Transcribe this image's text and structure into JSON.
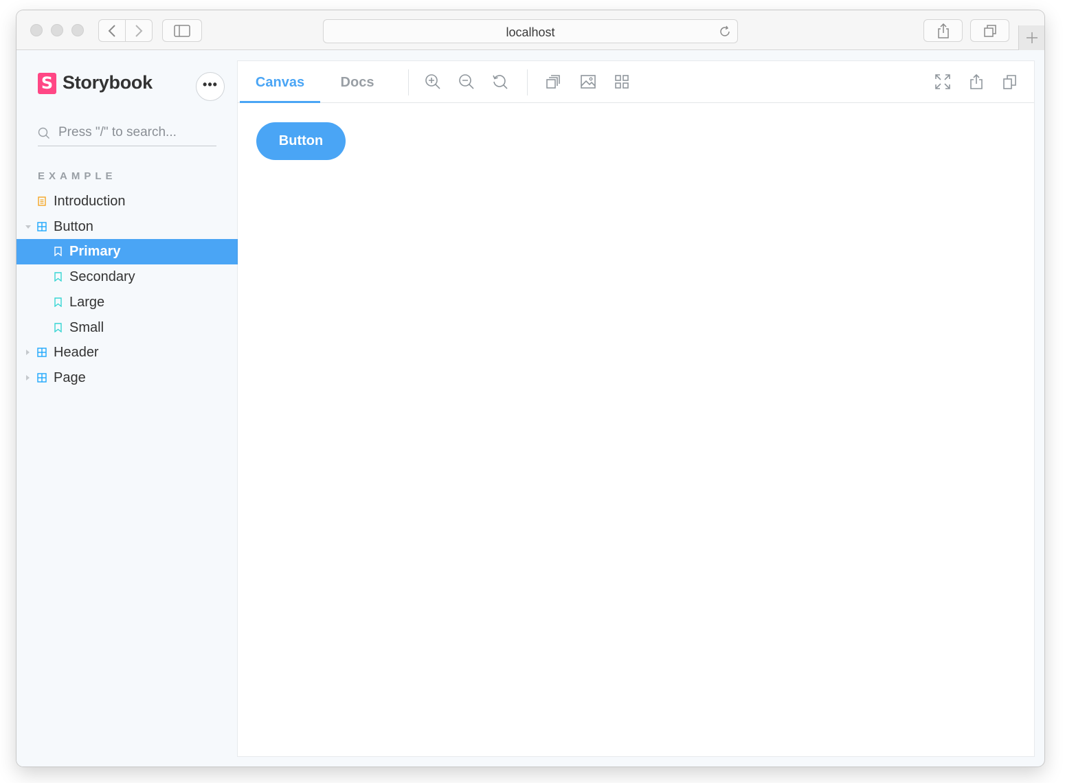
{
  "browser": {
    "url": "localhost"
  },
  "sidebar": {
    "logo_text": "Storybook",
    "logo_letter": "S",
    "menu_label": "•••",
    "search_placeholder": "Press \"/\" to search...",
    "section_title": "EXAMPLE",
    "items": [
      {
        "label": "Introduction",
        "type": "doc"
      },
      {
        "label": "Button",
        "type": "component",
        "expanded": true
      },
      {
        "label": "Primary",
        "type": "story",
        "selected": true
      },
      {
        "label": "Secondary",
        "type": "story"
      },
      {
        "label": "Large",
        "type": "story"
      },
      {
        "label": "Small",
        "type": "story"
      },
      {
        "label": "Header",
        "type": "component",
        "expanded": false
      },
      {
        "label": "Page",
        "type": "component",
        "expanded": false
      }
    ]
  },
  "toolbar": {
    "tabs": [
      {
        "label": "Canvas",
        "active": true
      },
      {
        "label": "Docs",
        "active": false
      }
    ],
    "tools_left": [
      "zoom-in-icon",
      "zoom-out-icon",
      "zoom-reset-icon",
      "background-icon",
      "image-icon",
      "grid-icon"
    ],
    "tools_right": [
      "fullscreen-icon",
      "share-icon",
      "copy-icon"
    ]
  },
  "canvas": {
    "button_label": "Button"
  },
  "colors": {
    "accent": "#4aa5f5",
    "brand": "#ff4785",
    "sidebar_bg": "#f6f9fc",
    "doc_icon": "#f5a623",
    "story_icon": "#37d5d3"
  }
}
